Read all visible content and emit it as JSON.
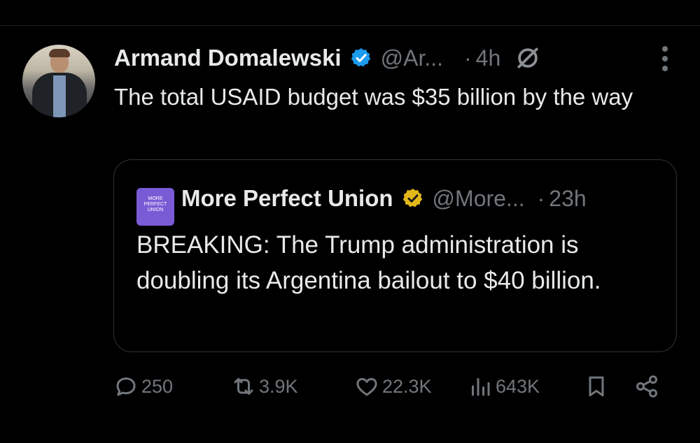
{
  "tweet": {
    "author_name": "Armand Domalewski",
    "handle": "@Ar...",
    "dot": "·",
    "time": "4h",
    "text": "The total USAID budget was $35 billion by the way"
  },
  "quote": {
    "logo_text": "MORE PERFECT UNION",
    "author_name": "More Perfect Union",
    "handle": "@More...",
    "dot": "·",
    "time": "23h",
    "text": "BREAKING: The Trump administration is doubling its Argentina bailout to $40 billion."
  },
  "stats": {
    "replies": "250",
    "reposts": "3.9K",
    "likes": "22.3K",
    "views": "643K"
  },
  "icons": [
    "verified-badge-icon",
    "grok-icon",
    "more-options-icon",
    "gold-verified-badge-icon",
    "reply-icon",
    "repost-icon",
    "like-icon",
    "views-icon",
    "bookmark-icon",
    "share-icon"
  ],
  "colors": {
    "background": "#000000",
    "text": "#e7e9ea",
    "muted": "#71767b",
    "verified_blue": "#1d9bf0",
    "verified_gold": "#e2b719",
    "border": "#2f3336"
  }
}
